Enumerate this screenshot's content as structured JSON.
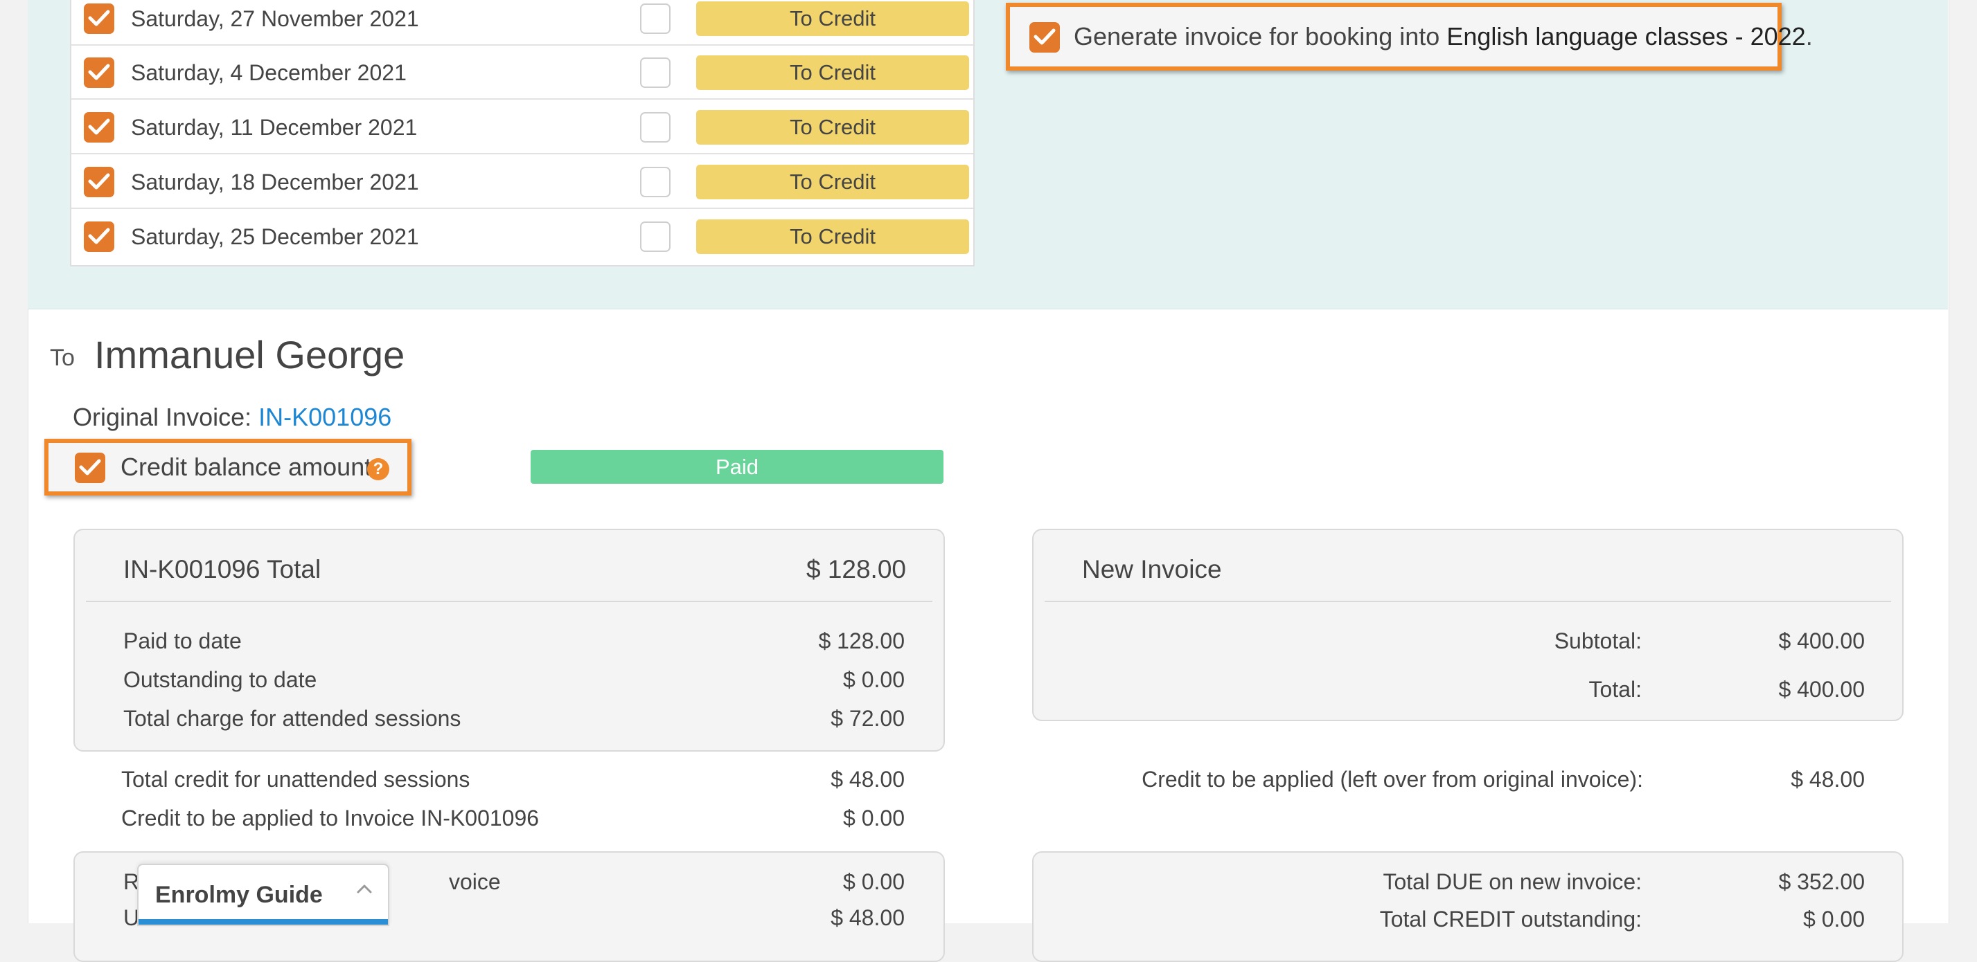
{
  "sessions": [
    {
      "date": "Saturday, 27 November 2021",
      "action": "To Credit"
    },
    {
      "date": "Saturday, 4 December 2021",
      "action": "To Credit"
    },
    {
      "date": "Saturday, 11 December 2021",
      "action": "To Credit"
    },
    {
      "date": "Saturday, 18 December 2021",
      "action": "To Credit"
    },
    {
      "date": "Saturday, 25 December 2021",
      "action": "To Credit"
    }
  ],
  "generate_invoice": {
    "prefix": "Generate invoice for booking into",
    "class_name": "English language classes - 2022",
    "suffix": "."
  },
  "recipient": {
    "to_label": "To",
    "name": "Immanuel George"
  },
  "original_invoice": {
    "label": "Original Invoice:",
    "number": "IN-K001096"
  },
  "credit_balance": {
    "label": "Credit balance amount.",
    "help_icon": "?",
    "status": "Paid"
  },
  "original_card": {
    "title": "IN-K001096 Total",
    "total": "$ 128.00",
    "rows": [
      {
        "label": "Paid to date",
        "value": "$ 128.00"
      },
      {
        "label": "Outstanding to date",
        "value": "$ 0.00"
      },
      {
        "label": "Total charge for attended sessions",
        "value": "$ 72.00"
      }
    ]
  },
  "credit_rows": [
    {
      "label": "Total credit for unattended sessions",
      "value": "$ 48.00"
    },
    {
      "label": "Credit to be applied to Invoice IN-K001096",
      "value": "$ 0.00"
    }
  ],
  "bottom_left": {
    "row1_label_start": "R",
    "row1_label_end": "voice",
    "row1_value": "$ 0.00",
    "row2_label_start": "U",
    "row2_value": "$ 48.00"
  },
  "new_invoice": {
    "title": "New Invoice",
    "subtotal_label": "Subtotal:",
    "subtotal_value": "$ 400.00",
    "total_label": "Total:",
    "total_value": "$ 400.00"
  },
  "credit_applied": {
    "label": "Credit to be applied (left over from original invoice):",
    "value": "$ 48.00"
  },
  "summary": {
    "due_label": "Total DUE on new invoice:",
    "due_value": "$ 352.00",
    "credit_out_label": "Total CREDIT outstanding:",
    "credit_out_value": "$ 0.00"
  },
  "guide": {
    "title": "Enrolmy Guide"
  },
  "colors": {
    "accent_orange": "#f0892b",
    "checkbox_orange": "#e37a2b",
    "credit_yellow": "#f2d46c",
    "paid_green": "#68d49a",
    "link_blue": "#1d87d4"
  }
}
